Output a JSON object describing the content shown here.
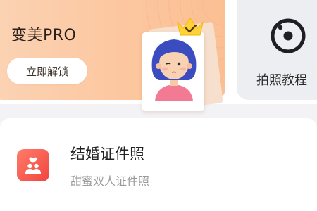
{
  "pro_card": {
    "title": "变美PRO",
    "unlock_label": "立即解锁"
  },
  "tutorial_card": {
    "label": "拍照教程"
  },
  "list": {
    "items": [
      {
        "title": "结婚证件照",
        "subtitle": "甜蜜双人证件照",
        "icon": "couple-photo-icon"
      }
    ]
  },
  "colors": {
    "pro_gradient_start": "#fbd3b4",
    "pro_gradient_end": "#fbbf93",
    "crown": "#ffd23a",
    "icon_red": "#f2453f",
    "tutorial_bg": "#eceef1"
  }
}
